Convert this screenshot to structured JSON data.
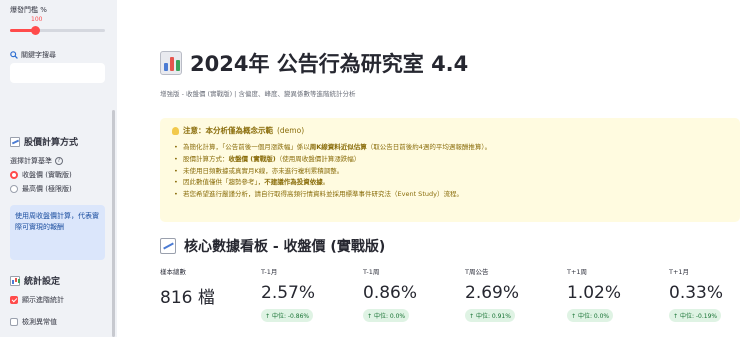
{
  "sidebar": {
    "slider": {
      "label": "爆發門檻 %",
      "value": "100",
      "fraction": 0.27
    },
    "search": {
      "label": "關鍵字搜尋",
      "value": ""
    },
    "calc_section": {
      "title": "股價計算方式"
    },
    "radio": {
      "label": "選擇計算基準",
      "options": [
        {
          "label": "收盤價 (實戰版)",
          "selected": true
        },
        {
          "label": "最高價 (極限版)",
          "selected": false
        }
      ]
    },
    "info": "使用周收盤價計算，代表實際可實現的報酬",
    "stats_section": {
      "title": "統計設定"
    },
    "checkboxes": [
      {
        "label": "顯示進階統計",
        "checked": true
      },
      {
        "label": "檢測異常值",
        "checked": false
      }
    ]
  },
  "main": {
    "title": "2024年 公告行為研究室 4.4",
    "subtitle": "增強版 - 收盤價 (實戰版) | 含偏度、峰度、變異係數等進階統計分析",
    "warning": {
      "title_bold": "注意：本分析僅為概念示範",
      "title_rest": "(demo)",
      "items": [
        {
          "pre": "為簡化計算，「公告前後一個月漲跌幅」係以",
          "bold": "周K線資料近似估算",
          "post": "（取公告日前後約4週的平均週報酬推算）。"
        },
        {
          "pre": "股價計算方式：",
          "bold": "收盤價 (實戰版)",
          "post": "（使用周收盤價計算漲跌幅）"
        },
        {
          "pre": "未使用日頻數據或真實月K線，亦未進行複利累積調整。",
          "bold": "",
          "post": ""
        },
        {
          "pre": "因此數值僅供「趨勢參考」，",
          "bold": "不建議作為投資依據",
          "post": "。"
        },
        {
          "pre": "若您希望進行嚴謹分析，請自行取得高頻行情資料並採用標準事件研究法（Event Study）流程。",
          "bold": "",
          "post": ""
        }
      ]
    },
    "kpi": {
      "title": "核心數據看板 - 收盤價 (實戰版)",
      "metrics": [
        {
          "label": "樣本總數",
          "value": "816 檔",
          "delta": ""
        },
        {
          "label": "T-1月",
          "value": "2.57%",
          "delta": "中位: -0.86%"
        },
        {
          "label": "T-1周",
          "value": "0.86%",
          "delta": "中位: 0.0%"
        },
        {
          "label": "T周公告",
          "value": "2.69%",
          "delta": "中位: 0.91%"
        },
        {
          "label": "T+1周",
          "value": "1.02%",
          "delta": "中位: 0.0%"
        },
        {
          "label": "T+1月",
          "value": "0.33%",
          "delta": "中位: -0.19%"
        }
      ]
    }
  },
  "colors": {
    "accent": "#ff4b4b",
    "delta_bg": "#dff3e4",
    "delta_fg": "#177233",
    "warn_bg": "#fffbe0",
    "info_bg": "#dbe6fb"
  },
  "icons": [
    "magnifier-icon",
    "line-chart-icon",
    "bar-chart-icon",
    "help-icon",
    "lightbulb-icon",
    "arrow-up-icon"
  ]
}
